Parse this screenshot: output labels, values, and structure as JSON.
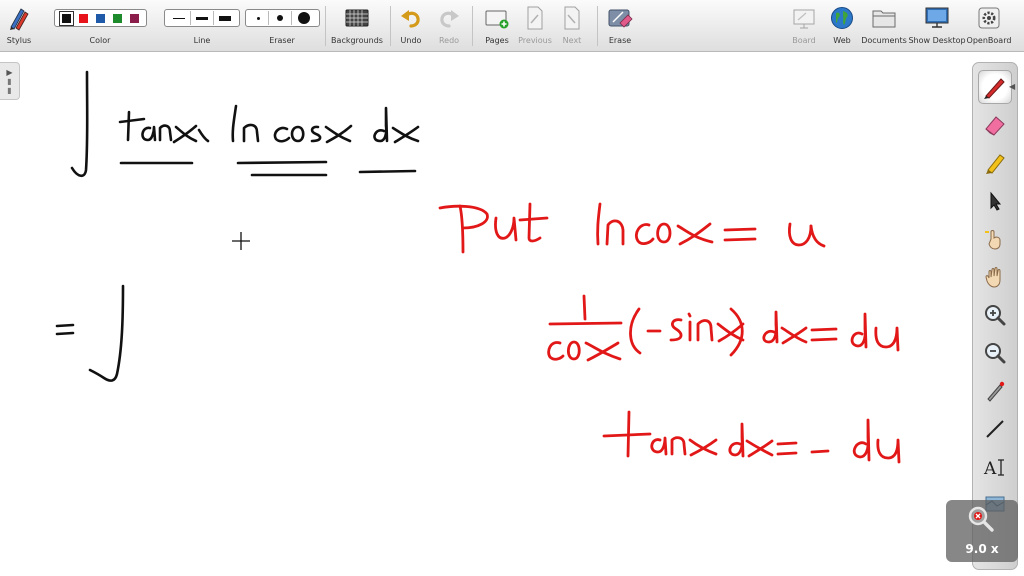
{
  "toolbar": {
    "stylus": "Stylus",
    "color": "Color",
    "line": "Line",
    "eraser": "Eraser",
    "backgrounds": "Backgrounds",
    "undo": "Undo",
    "redo": "Redo",
    "pages": "Pages",
    "previous": "Previous",
    "next": "Next",
    "erase": "Erase",
    "board": "Board",
    "web": "Web",
    "documents": "Documents",
    "show_desktop": "Show Desktop",
    "openboard": "OpenBoard"
  },
  "colors": {
    "palette": [
      "#111111",
      "#e8141b",
      "#1e5aa8",
      "#1d8a2b",
      "#8a1d4a"
    ],
    "ink_black": "#111111",
    "ink_red": "#e21818"
  },
  "icons": {
    "stylus": "pens-icon",
    "backgrounds": "grid-icon",
    "undo": "undo-arrow-icon",
    "redo": "redo-arrow-icon",
    "pages": "add-page-icon",
    "erase": "erase-board-icon",
    "board": "board-icon",
    "web": "globe-icon",
    "documents": "folder-icon",
    "show_desktop": "monitor-icon",
    "openboard": "gear-icon"
  },
  "palette_tools": [
    "pen",
    "eraser",
    "marker",
    "selector",
    "hand-pointer",
    "hand-pan",
    "zoom-in",
    "zoom-out",
    "laser-pointer",
    "line",
    "text",
    "capture"
  ],
  "zoom": {
    "label": "9.0 x"
  }
}
